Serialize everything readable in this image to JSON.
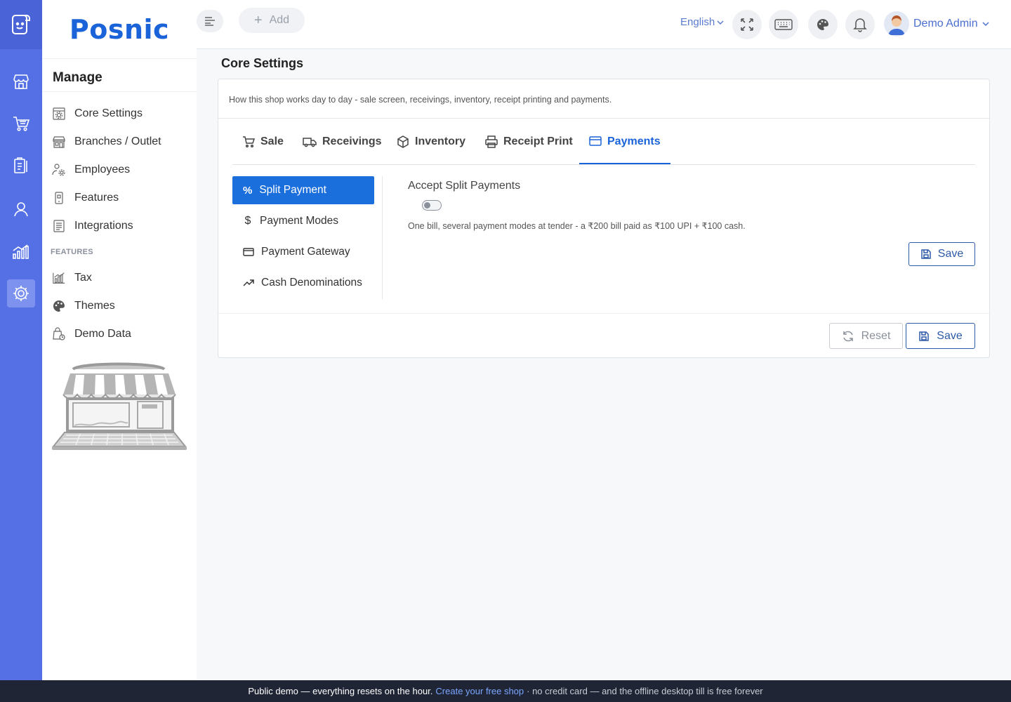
{
  "brand": {
    "name": "Posnic"
  },
  "sidebar": {
    "heading": "Manage",
    "items": [
      {
        "label": "Core Settings"
      },
      {
        "label": "Branches / Outlet"
      },
      {
        "label": "Employees"
      },
      {
        "label": "Features"
      },
      {
        "label": "Integrations"
      }
    ],
    "section_label": "FEATURES",
    "feature_items": [
      {
        "label": "Tax"
      },
      {
        "label": "Themes"
      },
      {
        "label": "Demo Data"
      }
    ]
  },
  "topbar": {
    "add_label": "Add",
    "language": "English",
    "user_name": "Demo Admin"
  },
  "page": {
    "title": "Core Settings",
    "description": "How this shop works day to day - sale screen, receivings, inventory, receipt printing and payments.",
    "tabs": [
      {
        "label": "Sale"
      },
      {
        "label": "Receivings"
      },
      {
        "label": "Inventory"
      },
      {
        "label": "Receipt Print"
      },
      {
        "label": "Payments"
      }
    ],
    "active_tab": "Payments",
    "subnav": [
      {
        "label": "Split Payment"
      },
      {
        "label": "Payment Modes"
      },
      {
        "label": "Payment Gateway"
      },
      {
        "label": "Cash Denominations"
      }
    ],
    "setting": {
      "label": "Accept Split Payments",
      "enabled": false,
      "help": "One bill, several payment modes at tender - a ₹200 bill paid as ₹100 UPI + ₹100 cash."
    },
    "save_inline_label": "Save",
    "footer": {
      "reset_label": "Reset",
      "save_label": "Save"
    }
  },
  "banner": {
    "lead": "Public demo — everything resets on the hour.",
    "link": "Create your free shop",
    "tail": "· no credit card — and the offline desktop till is free forever"
  },
  "colors": {
    "rail": "#5470e4",
    "accent": "#1a63d8",
    "active_subnav": "#1a6fdd",
    "banner": "#1f2535"
  }
}
